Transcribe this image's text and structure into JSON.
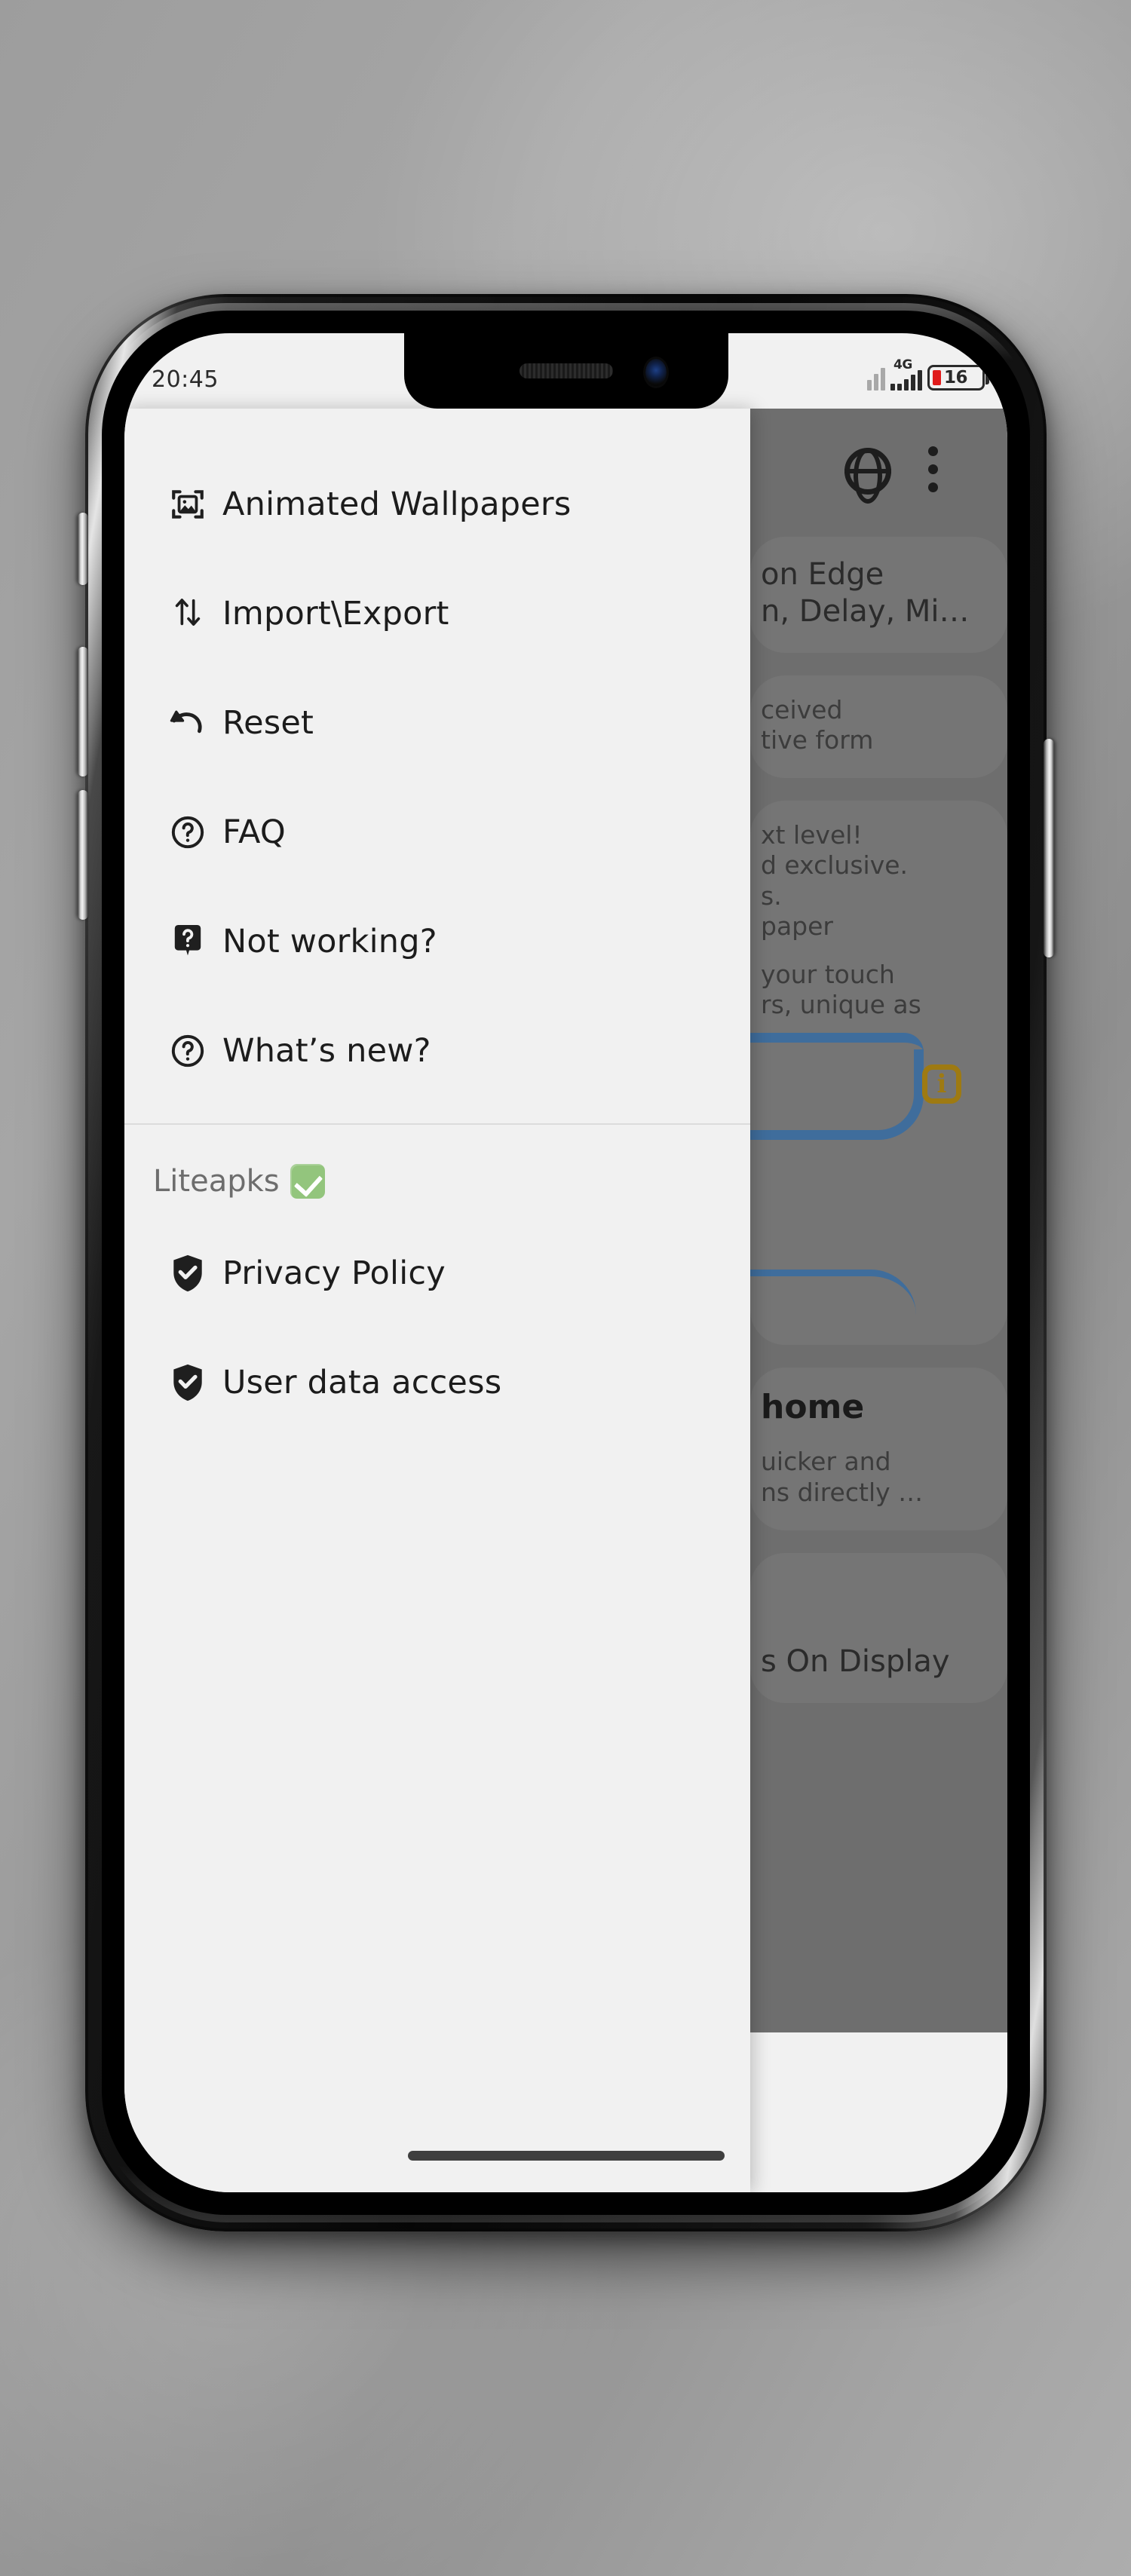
{
  "status_bar": {
    "time": "20:45",
    "network_type": "4G",
    "battery_percent": "16",
    "battery_color": "#e01b1b"
  },
  "drawer": {
    "menu_items": [
      {
        "label": "Animated Wallpapers",
        "icon": "image-frame-icon"
      },
      {
        "label": "Import\\Export",
        "icon": "import-export-arrows-icon"
      },
      {
        "label": "Reset",
        "icon": "undo-arrow-icon"
      },
      {
        "label": "FAQ",
        "icon": "question-circle-icon"
      },
      {
        "label": "Not working?",
        "icon": "question-tooltip-icon"
      },
      {
        "label": "What’s new?",
        "icon": "question-circle-icon"
      }
    ],
    "section": {
      "title": "Liteapks",
      "badge": "white-check-mark-emoji",
      "items": [
        {
          "label": "Privacy Policy",
          "icon": "shield-check-icon"
        },
        {
          "label": "User data access",
          "icon": "shield-check-icon"
        }
      ]
    }
  },
  "background_app": {
    "toolbar": {
      "globe": "globe-icon",
      "overflow": "kebab-menu-icon"
    },
    "visible_text_fragments": [
      "on Edge",
      "n, Delay, Mi…",
      "ceived",
      "tive form",
      "xt level!",
      "d exclusive.",
      "s.",
      "paper",
      "your touch",
      "rs, unique as",
      "home",
      "uicker and",
      "ns directly …",
      "s On Display"
    ],
    "edge_preview": {
      "shape_color": "#3f6d9c",
      "info_badge": "info-icon",
      "info_badge_color": "#9e7a12"
    }
  }
}
